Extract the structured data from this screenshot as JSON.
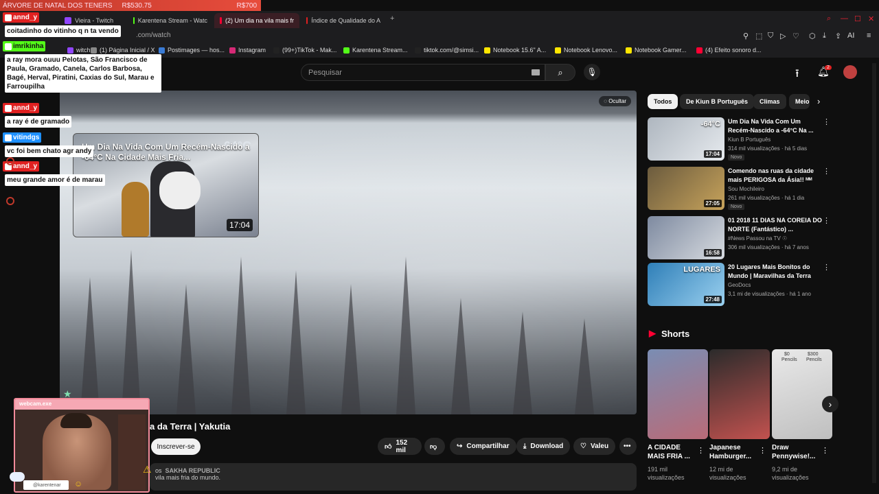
{
  "donation_bar": {
    "label": "ÁRVORE DE NATAL DOS TENERS",
    "amount1": "R$530.75",
    "amount2": "R$700"
  },
  "browser": {
    "tabs": [
      {
        "label": "Vieira - Twitch",
        "color": "#9146ff"
      },
      {
        "label": "Karentena Stream - Watc",
        "color": "#53fc18"
      },
      {
        "label": "(2) Um dia na vila mais fr",
        "color": "#ff0033",
        "active": true
      },
      {
        "label": "Índice de Qualidade do A",
        "color": "#e02020"
      }
    ],
    "new_tab": "+",
    "url": ".com/watch",
    "bookmarks": [
      {
        "label": "witch",
        "color": "#9146ff"
      },
      {
        "label": "(1) Página Inicial / X",
        "color": "#888"
      },
      {
        "label": "Postimages — hos...",
        "color": "#3a7bd5"
      },
      {
        "label": "Instagram",
        "color": "#d62976"
      },
      {
        "label": "(99+)TikTok - Mak...",
        "color": "#222"
      },
      {
        "label": "Karentena Stream...",
        "color": "#53fc18"
      },
      {
        "label": "tiktok.com/@simsi...",
        "color": "#222"
      },
      {
        "label": "Notebook 15.6\" A...",
        "color": "#ffe600"
      },
      {
        "label": "Notebook Lenovo...",
        "color": "#ffe600"
      },
      {
        "label": "Notebook Gamer...",
        "color": "#ffe600"
      },
      {
        "label": "(4) Efeito sonoro d...",
        "color": "#ff0033"
      }
    ]
  },
  "header": {
    "search_placeholder": "Pesquisar",
    "notif_count": "2"
  },
  "player": {
    "hide_label": "Ocultar",
    "mini_title": "Um Dia Na Vida Com Um Recém-Nascido a -64°C Na Cidade Mais Fria...",
    "mini_duration": "17:04",
    "mini_temp": "-64°C"
  },
  "video": {
    "title": "a da Terra | Yakutia",
    "subscribe": "Inscrever-se",
    "likes": "152 mil",
    "share": "Compartilhar",
    "download": "Download",
    "thanks": "Valeu",
    "desc_tag": "os",
    "desc_channel": "SAKHA REPUBLIC",
    "desc_line2": "vila mais fria do mundo."
  },
  "sidebar": {
    "chips": [
      "Todos",
      "De Kiun B Português",
      "Climas",
      "Meio"
    ],
    "recs": [
      {
        "title": "Um Dia Na Vida Com Um Recém-Nascido a -64°C Na ...",
        "channel": "Kiun B Português",
        "meta": "314 mil visualizações · há 5 dias",
        "duration": "17:04",
        "badge": "Novo",
        "thumb_text": "-64°C",
        "colors": [
          "#aeb6bf",
          "#e6eaee"
        ]
      },
      {
        "title": "Comendo nas ruas da cidade mais PERIGOSA da Ásia!! ᴹᴹ",
        "channel": "Sou Mochileiro",
        "meta": "261 mil visualizações · há 1 dia",
        "duration": "27:05",
        "badge": "Novo",
        "thumb_text": "",
        "colors": [
          "#6b5b3e",
          "#c7a35b"
        ]
      },
      {
        "title": "01 2018 11 DIAS NA COREIA DO NORTE (Fantástico) ...",
        "channel": "#News Passou na TV ☉",
        "meta": "306 mil visualizações · há 7 anos",
        "duration": "16:58",
        "badge": "",
        "thumb_text": "",
        "colors": [
          "#7e8aa0",
          "#d7dbe0"
        ]
      },
      {
        "title": "20 Lugares Mais Bonitos do Mundo | Maravilhas da Terra",
        "channel": "GeoDocs",
        "meta": "3,1 mi de visualizações · há 1 ano",
        "duration": "27:48",
        "badge": "",
        "thumb_text": "LUGARES",
        "colors": [
          "#2f7fb8",
          "#9ad0ef"
        ]
      }
    ],
    "shorts_title": "Shorts",
    "shorts": [
      {
        "title": "A CIDADE MAIS FRIA ...",
        "views": "191 mil visualizações",
        "colors": [
          "#7a8db3",
          "#b96b78"
        ]
      },
      {
        "title": "Japanese Hamburger...",
        "views": "12 mi de visualizações",
        "colors": [
          "#2b2b2b",
          "#c2524f"
        ]
      },
      {
        "title": "Draw Pennywise!...",
        "views": "9,2 mi de visualizações",
        "colors": [
          "#e9e9e9",
          "#bfbfbf"
        ],
        "price1": "$0",
        "price2": "$300",
        "caption": "Pencils"
      }
    ]
  },
  "chat": [
    {
      "user": "annd_y",
      "color": "#e02020",
      "msg": "coitadinho do vitinho q n ta vendo"
    },
    {
      "user": "imrikinha",
      "color": "#53fc18",
      "msg": "a ray mora ouuu Pelotas, São Francisco de Paula, Gramado, Canela, Carlos Barbosa, Bagé, Herval, Piratini, Caxias do Sul, Marau e Farroupilha"
    },
    {
      "user": "annd_y",
      "color": "#e02020",
      "msg": "a ray é de gramado"
    },
    {
      "user": "vitindgs",
      "color": "#1e90ff",
      "msg": "vc foi bem chato agr andy"
    },
    {
      "user": "annd_y",
      "color": "#e02020",
      "msg": "meu grande amor é de marau"
    }
  ],
  "webcam": {
    "title": "webcam.exe",
    "handle": "@karentenar"
  }
}
